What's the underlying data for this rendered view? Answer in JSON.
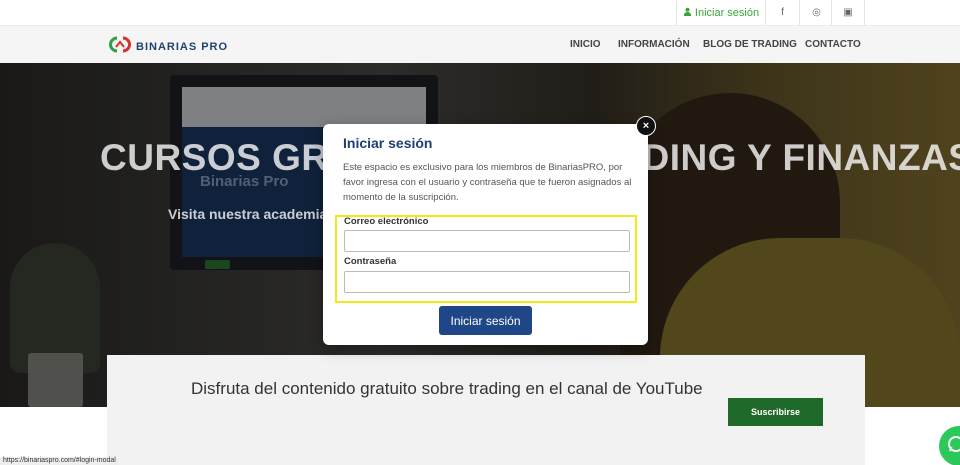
{
  "topbar": {
    "login_label": "Iniciar sesión",
    "social": [
      {
        "icon": "facebook-icon",
        "glyph": "f"
      },
      {
        "icon": "instagram-icon",
        "glyph": "◎"
      },
      {
        "icon": "youtube-icon",
        "glyph": "▣"
      }
    ]
  },
  "nav": {
    "brand": "BINARIAS PRO",
    "links": [
      "INICIO",
      "INFORMACIÓN",
      "BLOG DE TRADING",
      "CONTACTO"
    ]
  },
  "hero": {
    "title": "CURSOS GRATUITOS DE TRADING Y FINANZAS",
    "subtitle": "Visita nuestra academia gratuita con cursos sobre Trading y Finanzas",
    "screen_title": "Binarias Pro"
  },
  "modal": {
    "title": "Iniciar sesión",
    "description": "Este espacio es exclusivo para los miembros de BinariasPRO, por favor ingresa con el usuario y contraseña que te fueron asignados al momento de la suscripción.",
    "email_label": "Correo electrónico",
    "email_value": "",
    "password_label": "Contraseña",
    "password_value": "",
    "submit_label": "Iniciar sesión",
    "close_glyph": "×"
  },
  "youtube": {
    "text": "Disfruta del contenido gratuito sobre trading en el canal de YouTube",
    "button_label": "Suscribirse"
  },
  "status_bar": {
    "url": "https://binariaspro.com/#login-modal"
  },
  "colors": {
    "accent": "#1f4687",
    "highlight": "#f1ea1b",
    "green": "#3aa63a",
    "subscribe": "#1f6a2a"
  }
}
